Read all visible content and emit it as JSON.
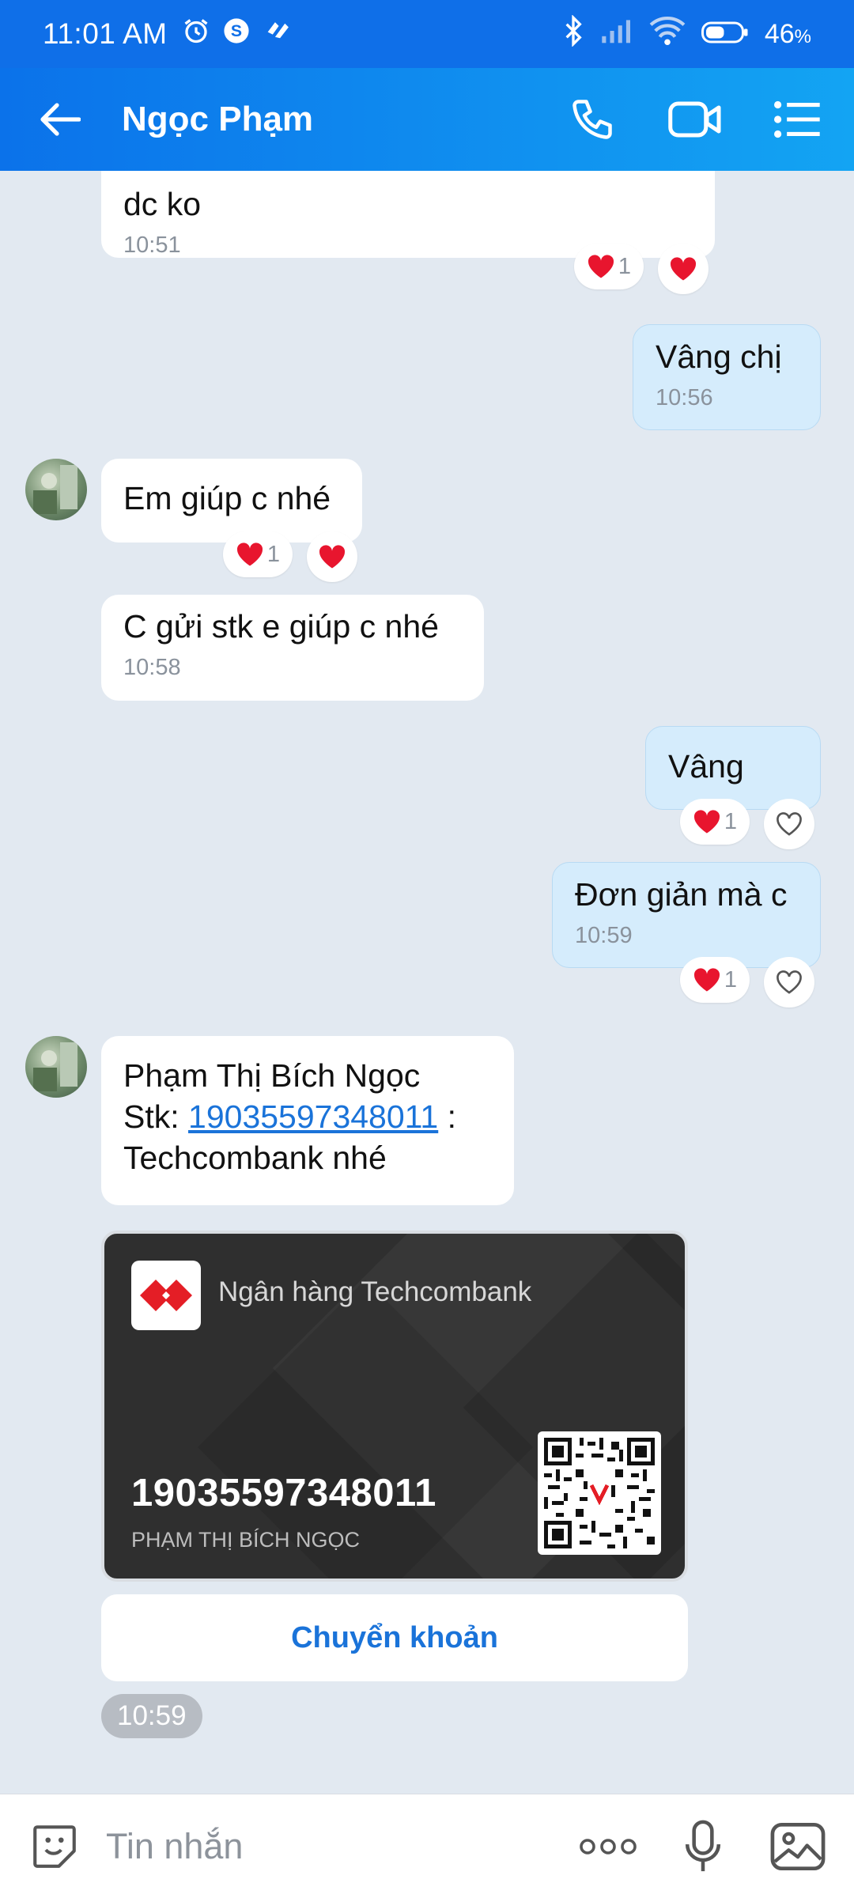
{
  "status": {
    "time": "11:01 AM",
    "battery": "46",
    "battery_unit": "%"
  },
  "header": {
    "title": "Ngọc Phạm"
  },
  "messages": {
    "m1": {
      "text": "dc ko",
      "time": "10:51",
      "react_count": "1"
    },
    "m2": {
      "text": "Vâng chị",
      "time": "10:56"
    },
    "m3": {
      "text": "Em giúp c nhé",
      "react_count": "1"
    },
    "m4": {
      "text": "C gửi stk e giúp c nhé",
      "time": "10:58"
    },
    "m5": {
      "text": "Vâng",
      "react_count": "1"
    },
    "m6": {
      "text": "Đơn giản mà c",
      "time": "10:59",
      "react_count": "1"
    },
    "m7": {
      "line1": "Phạm Thị Bích Ngọc",
      "stk_prefix": "Stk: ",
      "account": "19035597348011",
      "colon": " :",
      "line3": "Techcombank nhé"
    }
  },
  "bank_card": {
    "bank_name": "Ngân hàng Techcombank",
    "account_number": "19035597348011",
    "holder": "PHẠM THỊ BÍCH NGỌC",
    "action": "Chuyển khoản",
    "time": "10:59"
  },
  "input": {
    "placeholder": "Tin nhắn"
  },
  "colors": {
    "header": "#0f6fe8",
    "accent": "#1a73d9",
    "heart": "#e8152e"
  }
}
